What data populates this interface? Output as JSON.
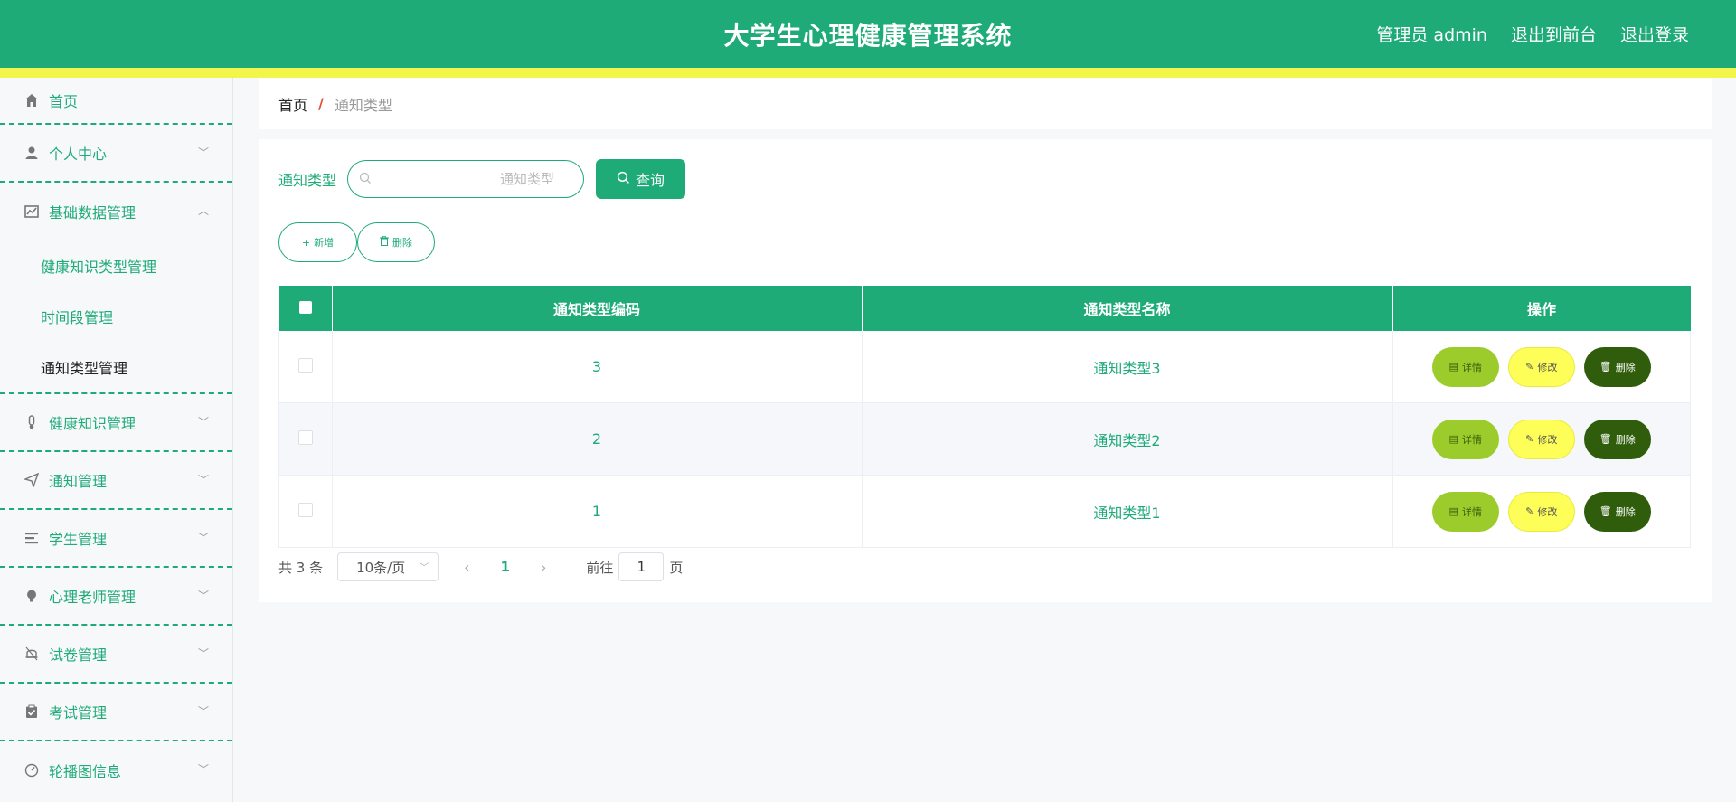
{
  "header": {
    "title": "大学生心理健康管理系统",
    "links": [
      "管理员 admin",
      "退出到前台",
      "退出登录"
    ]
  },
  "sidebar": {
    "items": [
      {
        "label": "首页",
        "icon": "home-icon",
        "chevron": ""
      },
      {
        "label": "个人中心",
        "icon": "user-icon",
        "chevron": "﹀"
      },
      {
        "label": "基础数据管理",
        "icon": "chart-icon",
        "chevron": "︿",
        "children": [
          "健康知识类型管理",
          "时间段管理",
          "通知类型管理"
        ]
      },
      {
        "label": "健康知识管理",
        "icon": "thermometer-icon",
        "chevron": "﹀"
      },
      {
        "label": "通知管理",
        "icon": "send-icon",
        "chevron": "﹀"
      },
      {
        "label": "学生管理",
        "icon": "list-icon",
        "chevron": "﹀"
      },
      {
        "label": "心理老师管理",
        "icon": "bulb-icon",
        "chevron": "﹀"
      },
      {
        "label": "试卷管理",
        "icon": "bell-icon",
        "chevron": "﹀"
      },
      {
        "label": "考试管理",
        "icon": "clipboard-icon",
        "chevron": "﹀"
      },
      {
        "label": "轮播图信息",
        "icon": "gauge-icon",
        "chevron": "﹀"
      }
    ]
  },
  "breadcrumb": {
    "home": "首页",
    "separator": "/",
    "current": "通知类型"
  },
  "search": {
    "label": "通知类型",
    "placeholder": "通知类型",
    "value": "",
    "button": "查询"
  },
  "actions": {
    "add": "新增",
    "delete": "删除"
  },
  "table": {
    "columns": [
      "通知类型编码",
      "通知类型名称",
      "操作"
    ],
    "rows": [
      {
        "code": "3",
        "name": "通知类型3"
      },
      {
        "code": "2",
        "name": "通知类型2"
      },
      {
        "code": "1",
        "name": "通知类型1"
      }
    ],
    "op_labels": {
      "detail": "详情",
      "edit": "修改",
      "delete": "删除"
    }
  },
  "pagination": {
    "total": "共 3 条",
    "page_size": "10条/页",
    "current": "1",
    "goto_label": "前往",
    "goto_value": "1",
    "unit": "页"
  },
  "colors": {
    "primary": "#1eab78",
    "stripe": "#f3f64a",
    "detail": "#9ccc2c",
    "edit": "#fefe58",
    "delete": "#2f5d0b"
  }
}
